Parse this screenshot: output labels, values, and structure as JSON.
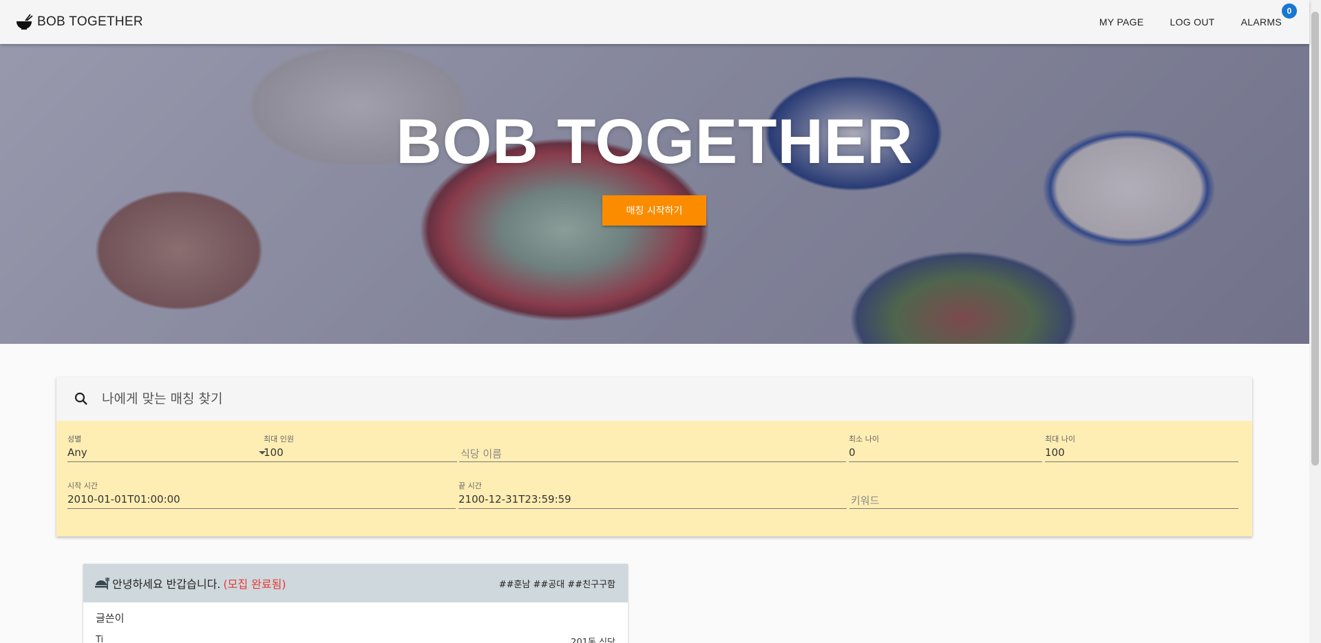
{
  "app": {
    "title": "BOB TOGETHER"
  },
  "nav": {
    "mypage": "MY PAGE",
    "logout": "LOG OUT",
    "alarms": "ALARMS",
    "alarm_count": "0"
  },
  "hero": {
    "title": "BOB TOGETHER",
    "button": "매칭 시작하기"
  },
  "search": {
    "placeholder": "나에게 맞는 매칭 찾기",
    "filters": {
      "gender": {
        "label": "성별",
        "value": "Any"
      },
      "max_people": {
        "label": "최대 인원",
        "value": "100"
      },
      "restaurant": {
        "placeholder": "식당 이름"
      },
      "min_age": {
        "label": "최소 나이",
        "value": "0"
      },
      "max_age": {
        "label": "최대 나이",
        "value": "100"
      },
      "start_time": {
        "label": "시작 시간",
        "value": "2010-01-01T01:00:00"
      },
      "end_time": {
        "label": "끝 시간",
        "value": "2100-12-31T23:59:59"
      },
      "keyword": {
        "placeholder": "키워드"
      }
    }
  },
  "posts": [
    {
      "title": "안녕하세요 반갑습니다.",
      "status": "(모집 완료됨)",
      "tags": "##훈남 ##공대 ##친구구함",
      "author_label": "글쓴이",
      "row_left": "Ti",
      "row_right": "201동 식당"
    }
  ],
  "colors": {
    "accent": "#fb8c00",
    "badge": "#1976d2",
    "panel": "#ffeeb3",
    "status": "#e53935"
  }
}
